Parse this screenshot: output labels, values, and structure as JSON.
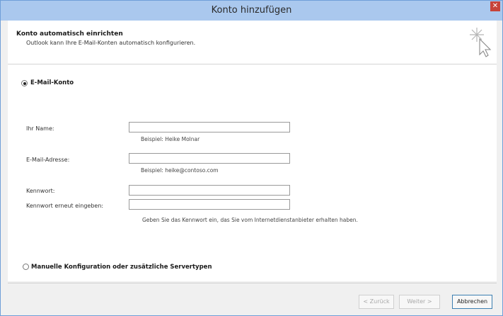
{
  "window": {
    "title": "Konto hinzufügen",
    "close_glyph": "✕"
  },
  "header": {
    "title": "Konto automatisch einrichten",
    "subtitle": "Outlook kann Ihre E-Mail-Konten automatisch konfigurieren.",
    "icon": "wizard-cursor-icon"
  },
  "options": {
    "email_account": {
      "label": "E-Mail-Konto",
      "checked": true
    },
    "manual_config": {
      "label": "Manuelle Konfiguration oder zusätzliche Servertypen",
      "checked": false
    }
  },
  "form": {
    "name": {
      "label": "Ihr Name:",
      "value": "",
      "hint": "Beispiel: Heike Molnar"
    },
    "email": {
      "label": "E-Mail-Adresse:",
      "value": "",
      "hint": "Beispiel: heike@contoso.com"
    },
    "password": {
      "label": "Kennwort:",
      "value": ""
    },
    "password_confirm": {
      "label": "Kennwort erneut eingeben:",
      "value": ""
    },
    "password_hint": "Geben Sie das Kennwort ein, das Sie vom Internetdienstanbieter erhalten haben."
  },
  "footer": {
    "back": "< Zurück",
    "next": "Weiter >",
    "cancel": "Abbrechen"
  },
  "colors": {
    "titlebar": "#aac8ee",
    "close": "#c7433a"
  }
}
